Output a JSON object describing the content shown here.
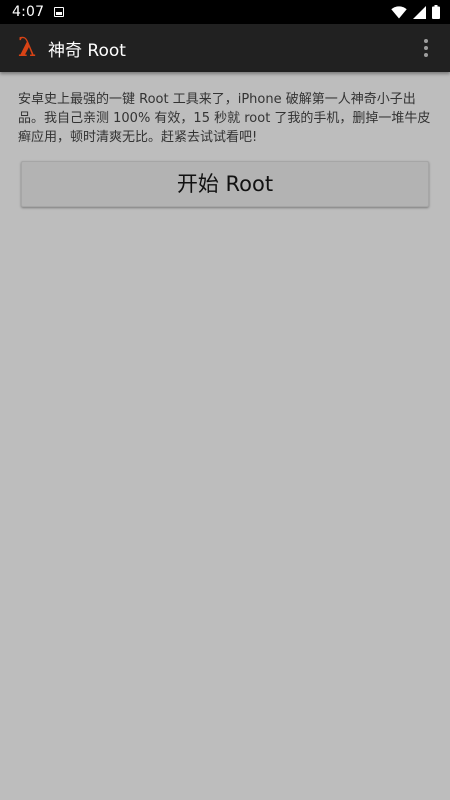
{
  "status_bar": {
    "time": "4:07",
    "icons": [
      "notification-icon",
      "wifi-icon",
      "signal-icon",
      "battery-icon"
    ]
  },
  "app_bar": {
    "logo_glyph": "λ",
    "logo_color": "#d84315",
    "title": "神奇 Root",
    "overflow_icon": "more-vert-icon"
  },
  "main": {
    "description": "安卓史上最强的一键 Root 工具来了，iPhone 破解第一人神奇小子出品。我自己亲测 100% 有效，15 秒就 root 了我的手机，删掉一堆牛皮癣应用，顿时清爽无比。赶紧去试试看吧!",
    "start_button_label": "开始 Root"
  },
  "colors": {
    "status_bar_bg": "#000000",
    "app_bar_bg": "#212121",
    "page_bg": "#bdbdbd",
    "button_bg": "#b3b3b3"
  }
}
